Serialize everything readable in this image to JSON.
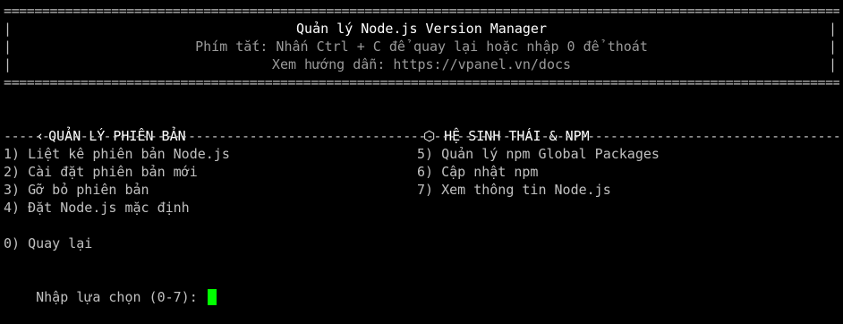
{
  "window": {
    "title": "Quản lý Node.js Version Manager",
    "shortcut_hint": "Phím tắt: Nhấn Ctrl + C để quay lại hoặc nhập 0 để thoát",
    "docs_hint": "Xem hướng dẫn: https://vpanel.vn/docs"
  },
  "sections": {
    "left_heading": "QUẢN LÝ PHIÊN BẢN",
    "left_icon": "back-arrow-icon",
    "right_heading": "HỆ SINH THÁI & NPM",
    "right_icon": "package-box-icon"
  },
  "menu": {
    "left_items": [
      "1) Liệt kê phiên bản Node.js",
      "2) Cài đặt phiên bản mới",
      "3) Gỡ bỏ phiên bản",
      "4) Đặt Node.js mặc định"
    ],
    "right_items": [
      "5) Quản lý npm Global Packages",
      "6) Cập nhật npm",
      "7) Xem thông tin Node.js"
    ],
    "back_item": "0) Quay lại"
  },
  "prompt": {
    "label": "Nhập lựa chọn (0-7): ",
    "value": ""
  },
  "colors": {
    "background": "#000000",
    "text": "#c0c0c0",
    "cursor": "#00ff00"
  }
}
